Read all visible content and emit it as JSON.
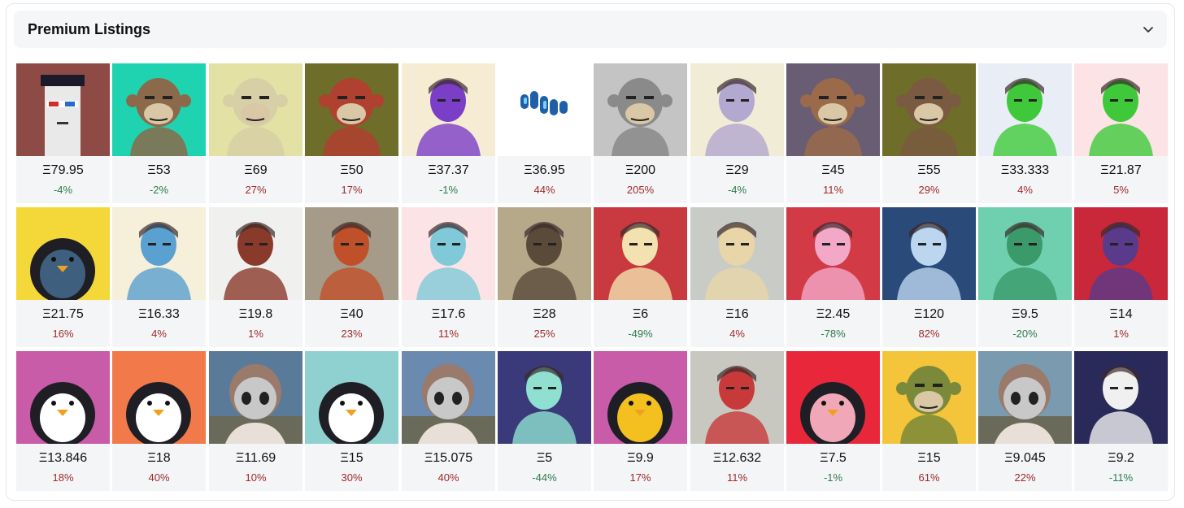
{
  "panel": {
    "title": "Premium Listings",
    "toggle_icon": "chevron-down-icon"
  },
  "listings": [
    {
      "price": "Ξ79.95",
      "change": "-4%",
      "dir": "down",
      "bg": "#8e4a45",
      "fg": "#e9e9e9",
      "kind": "punk"
    },
    {
      "price": "Ξ53",
      "change": "-2%",
      "dir": "down",
      "bg": "#20d3b0",
      "fg": "#8a6a4a",
      "kind": "ape"
    },
    {
      "price": "Ξ69",
      "change": "27%",
      "dir": "up",
      "bg": "#e3e2a4",
      "fg": "#d7cfa6",
      "kind": "ape"
    },
    {
      "price": "Ξ50",
      "change": "17%",
      "dir": "up",
      "bg": "#6f6d2a",
      "fg": "#b0402f",
      "kind": "ape"
    },
    {
      "price": "Ξ37.37",
      "change": "-1%",
      "dir": "down",
      "bg": "#f5ecd3",
      "fg": "#7a3ec7",
      "kind": "person"
    },
    {
      "price": "Ξ36.95",
      "change": "44%",
      "dir": "up",
      "bg": "#ffffff",
      "fg": "#1f5fa8",
      "kind": "blob"
    },
    {
      "price": "Ξ200",
      "change": "205%",
      "dir": "up",
      "bg": "#c4c4c4",
      "fg": "#8a8a8a",
      "kind": "ape"
    },
    {
      "price": "Ξ29",
      "change": "-4%",
      "dir": "down",
      "bg": "#f1ecd6",
      "fg": "#b3a8d0",
      "kind": "person"
    },
    {
      "price": "Ξ45",
      "change": "11%",
      "dir": "up",
      "bg": "#695d73",
      "fg": "#9a6a4a",
      "kind": "ape"
    },
    {
      "price": "Ξ55",
      "change": "29%",
      "dir": "up",
      "bg": "#6f6d2a",
      "fg": "#7a5a40",
      "kind": "ape"
    },
    {
      "price": "Ξ33.333",
      "change": "4%",
      "dir": "up",
      "bg": "#e9edf5",
      "fg": "#3fc93a",
      "kind": "person"
    },
    {
      "price": "Ξ21.87",
      "change": "5%",
      "dir": "up",
      "bg": "#fbe3e6",
      "fg": "#3fc93a",
      "kind": "person"
    },
    {
      "price": "Ξ21.75",
      "change": "16%",
      "dir": "up",
      "bg": "#f4d83a",
      "fg": "#3f5f7f",
      "kind": "penguin"
    },
    {
      "price": "Ξ16.33",
      "change": "4%",
      "dir": "up",
      "bg": "#f6efd9",
      "fg": "#5aa0d0",
      "kind": "person"
    },
    {
      "price": "Ξ19.8",
      "change": "1%",
      "dir": "up",
      "bg": "#f0f0ee",
      "fg": "#8a3a2a",
      "kind": "person"
    },
    {
      "price": "Ξ40",
      "change": "23%",
      "dir": "up",
      "bg": "#a69a88",
      "fg": "#c0502a",
      "kind": "person"
    },
    {
      "price": "Ξ17.6",
      "change": "11%",
      "dir": "up",
      "bg": "#fbe3e6",
      "fg": "#7fc9d8",
      "kind": "person"
    },
    {
      "price": "Ξ28",
      "change": "25%",
      "dir": "up",
      "bg": "#b6a98a",
      "fg": "#5a4a3a",
      "kind": "person"
    },
    {
      "price": "Ξ6",
      "change": "-49%",
      "dir": "down",
      "bg": "#c83a3f",
      "fg": "#f3e2b0",
      "kind": "person"
    },
    {
      "price": "Ξ16",
      "change": "4%",
      "dir": "up",
      "bg": "#c9cbc7",
      "fg": "#e9d6a8",
      "kind": "person"
    },
    {
      "price": "Ξ2.45",
      "change": "-78%",
      "dir": "down",
      "bg": "#d23a46",
      "fg": "#f3a8c8",
      "kind": "person"
    },
    {
      "price": "Ξ120",
      "change": "82%",
      "dir": "up",
      "bg": "#2a4a7a",
      "fg": "#bcd6f0",
      "kind": "person"
    },
    {
      "price": "Ξ9.5",
      "change": "-20%",
      "dir": "down",
      "bg": "#6fd0b0",
      "fg": "#3a9a6a",
      "kind": "person"
    },
    {
      "price": "Ξ14",
      "change": "1%",
      "dir": "up",
      "bg": "#c8283a",
      "fg": "#5a3a8a",
      "kind": "person"
    },
    {
      "price": "Ξ13.846",
      "change": "18%",
      "dir": "up",
      "bg": "#c85ca8",
      "fg": "#ffffff",
      "kind": "penguin"
    },
    {
      "price": "Ξ18",
      "change": "40%",
      "dir": "up",
      "bg": "#f27a4a",
      "fg": "#ffffff",
      "kind": "penguin"
    },
    {
      "price": "Ξ11.69",
      "change": "10%",
      "dir": "up",
      "bg": "#5a7a9a",
      "fg": "#c8c8c8",
      "kind": "doll"
    },
    {
      "price": "Ξ15",
      "change": "30%",
      "dir": "up",
      "bg": "#8fd0d0",
      "fg": "#ffffff",
      "kind": "penguin"
    },
    {
      "price": "Ξ15.075",
      "change": "40%",
      "dir": "up",
      "bg": "#6a8ab0",
      "fg": "#c8c8c8",
      "kind": "doll"
    },
    {
      "price": "Ξ5",
      "change": "-44%",
      "dir": "down",
      "bg": "#3a3a7a",
      "fg": "#8fe0d0",
      "kind": "person"
    },
    {
      "price": "Ξ9.9",
      "change": "17%",
      "dir": "up",
      "bg": "#c85ca8",
      "fg": "#f4c020",
      "kind": "penguin"
    },
    {
      "price": "Ξ12.632",
      "change": "11%",
      "dir": "up",
      "bg": "#c8c8c0",
      "fg": "#c83a3a",
      "kind": "person"
    },
    {
      "price": "Ξ7.5",
      "change": "-1%",
      "dir": "down",
      "bg": "#e8283a",
      "fg": "#f0a8b8",
      "kind": "penguin"
    },
    {
      "price": "Ξ15",
      "change": "61%",
      "dir": "up",
      "bg": "#f4c43a",
      "fg": "#7a8a3a",
      "kind": "ape"
    },
    {
      "price": "Ξ9.045",
      "change": "22%",
      "dir": "up",
      "bg": "#7a9ab0",
      "fg": "#c8c8c8",
      "kind": "doll"
    },
    {
      "price": "Ξ9.2",
      "change": "-11%",
      "dir": "down",
      "bg": "#2a2a5a",
      "fg": "#f0f0f0",
      "kind": "person"
    }
  ]
}
